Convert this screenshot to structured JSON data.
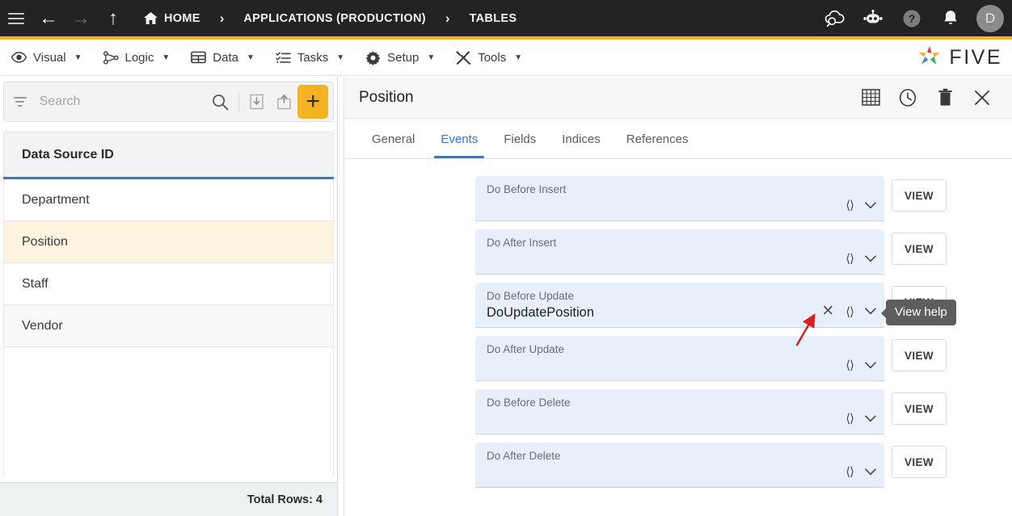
{
  "topbar": {
    "menu_icon": "hamburger-icon",
    "back_icon": "back-arrow-icon",
    "forward_icon": "forward-arrow-icon",
    "up_icon": "up-arrow-icon",
    "breadcrumbs": [
      {
        "label": "HOME",
        "icon": "home-icon"
      },
      {
        "label": "APPLICATIONS (PRODUCTION)",
        "icon": ""
      },
      {
        "label": "TABLES",
        "icon": ""
      }
    ],
    "separator": "›",
    "right_icons": [
      {
        "name": "cloud-check-icon",
        "label": ""
      },
      {
        "name": "robot-assistant-icon",
        "label": ""
      },
      {
        "name": "help-icon",
        "label": "?"
      },
      {
        "name": "notifications-bell-icon",
        "label": ""
      }
    ],
    "avatar_initial": "D"
  },
  "menubar": {
    "items": [
      {
        "label": "Visual",
        "icon": "eye-icon",
        "caret": "▼"
      },
      {
        "label": "Logic",
        "icon": "logic-flow-icon",
        "caret": "▼"
      },
      {
        "label": "Data",
        "icon": "grid-table-icon",
        "caret": "▼"
      },
      {
        "label": "Tasks",
        "icon": "checklist-icon",
        "caret": "▼"
      },
      {
        "label": "Setup",
        "icon": "gear-icon",
        "caret": "▼"
      },
      {
        "label": "Tools",
        "icon": "tools-icon",
        "caret": "▼"
      }
    ],
    "brand": "FIVE"
  },
  "sidebar": {
    "search": {
      "placeholder": "Search",
      "value": ""
    },
    "toolbar": [
      {
        "name": "filter-icon"
      },
      {
        "name": "search-icon"
      },
      {
        "name": "import-icon"
      },
      {
        "name": "export-icon"
      },
      {
        "name": "add-icon",
        "label": "+"
      }
    ],
    "column_header": "Data Source ID",
    "rows": [
      {
        "label": "Department",
        "selected": false
      },
      {
        "label": "Position",
        "selected": true
      },
      {
        "label": "Staff",
        "selected": false
      },
      {
        "label": "Vendor",
        "selected": false
      }
    ],
    "footer": "Total Rows: 4"
  },
  "panel": {
    "title": "Position",
    "header_icons": [
      {
        "name": "table-grid-icon"
      },
      {
        "name": "history-clock-icon"
      },
      {
        "name": "delete-trash-icon"
      },
      {
        "name": "close-icon"
      }
    ],
    "tabs": [
      {
        "label": "General",
        "active": false
      },
      {
        "label": "Events",
        "active": true
      },
      {
        "label": "Fields",
        "active": false
      },
      {
        "label": "Indices",
        "active": false
      },
      {
        "label": "References",
        "active": false
      }
    ],
    "view_button_label": "VIEW",
    "events": [
      {
        "label": "Do Before Insert",
        "value": "",
        "has_clear": false
      },
      {
        "label": "Do After Insert",
        "value": "",
        "has_clear": false
      },
      {
        "label": "Do Before Update",
        "value": "DoUpdatePosition",
        "has_clear": true
      },
      {
        "label": "Do After Update",
        "value": "",
        "has_clear": false
      },
      {
        "label": "Do Before Delete",
        "value": "",
        "has_clear": false
      },
      {
        "label": "Do After Delete",
        "value": "",
        "has_clear": false
      }
    ]
  },
  "overlays": {
    "tooltip_text": "View help",
    "annotation_arrow_color": "#e01b1b"
  },
  "colors": {
    "topbar_bg": "#232323",
    "accent_yellow": "#f5b324",
    "tab_active_blue": "#2d7ad6",
    "field_blue": "#e7f0fa",
    "row_selected": "#fdf4e0",
    "tooltip_bg": "#5e5e5e"
  }
}
